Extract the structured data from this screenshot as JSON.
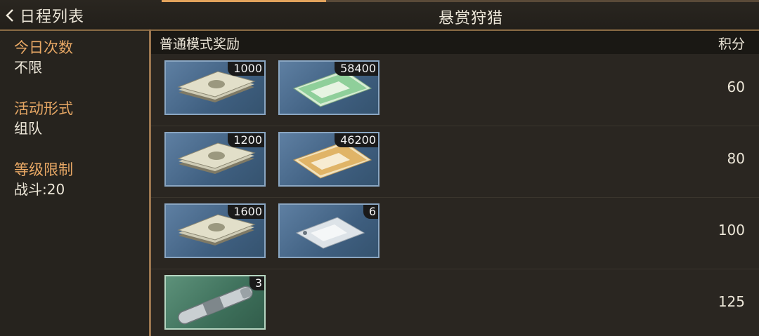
{
  "header": {
    "back_label": "日程列表",
    "title": "悬赏狩猎"
  },
  "sidebar": {
    "sections": [
      {
        "label": "今日次数",
        "value": "不限"
      },
      {
        "label": "活动形式",
        "value": "组队"
      },
      {
        "label": "等级限制",
        "value": "战斗:20"
      }
    ]
  },
  "main": {
    "header_left": "普通模式奖励",
    "header_right": "积分",
    "rows": [
      {
        "score": "60",
        "items": [
          {
            "icon": "cash-stack-icon",
            "count": "1000"
          },
          {
            "icon": "green-envelope-icon",
            "count": "58400"
          }
        ]
      },
      {
        "score": "80",
        "items": [
          {
            "icon": "cash-stack-icon",
            "count": "1200"
          },
          {
            "icon": "gold-envelope-icon",
            "count": "46200"
          }
        ]
      },
      {
        "score": "100",
        "items": [
          {
            "icon": "cash-stack-icon",
            "count": "1600"
          },
          {
            "icon": "sealed-bag-icon",
            "count": "6"
          }
        ]
      },
      {
        "score": "125",
        "items": [
          {
            "icon": "syringe-capsule-icon",
            "count": "3"
          }
        ]
      }
    ]
  },
  "colors": {
    "accent": "#e8a865",
    "divider": "#9b7650",
    "item_blue": "#4f7192",
    "item_green": "#4a806a"
  }
}
